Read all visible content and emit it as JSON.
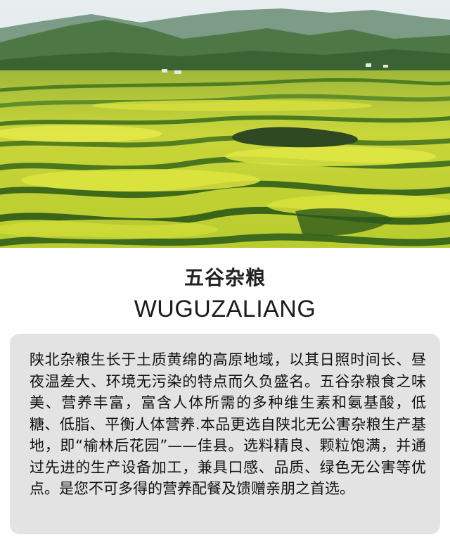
{
  "hero": {
    "image": "terraced-rapeseed-fields-photo",
    "colors": {
      "sky": "#d9e4e6",
      "mountain_far": "#6d8f79",
      "mountain_near": "#3f6a3a",
      "field_yellow": "#d6e03a",
      "field_green": "#5d8f2a",
      "field_dark": "#2d4a1c"
    }
  },
  "title_cn": "五谷杂粮",
  "title_en": "WUGUZALIANG",
  "description": "陕北杂粮生长于土质黄绵的高原地域，以其日照时间长、昼夜温差大、环境无污染的特点而久负盛名。五谷杂粮食之味美、营养丰富，富含人体所需的多种维生素和氨基酸，低糖、低脂、平衡人体营养.本品更选自陕北无公害杂粮生产基地，即“榆林后花园”——佳县。选料精良、颗粒饱满，并通过先进的生产设备加工，兼具口感、品质、绿色无公害等优点。是您不可多得的营养配餐及馈赠亲朋之首选。",
  "colors": {
    "panel_background": "#e3e3e3",
    "text": "#111111"
  }
}
